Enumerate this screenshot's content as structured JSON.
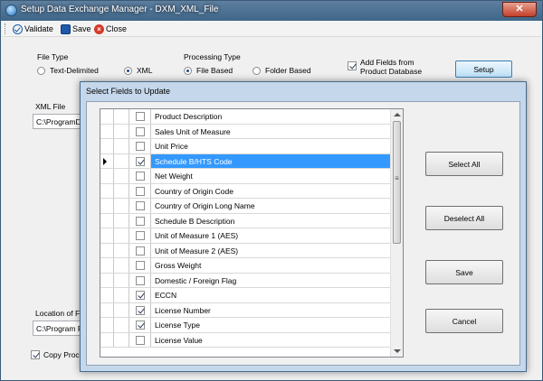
{
  "window": {
    "title": "Setup Data Exchange Manager - DXM_XML_File",
    "close_glyph": "✕"
  },
  "toolbar": {
    "validate_label": "Validate",
    "save_label": "Save",
    "close_label": "Close"
  },
  "file_type": {
    "label": "File Type",
    "options": [
      "Text-Delimited",
      "XML"
    ],
    "selected": "XML"
  },
  "processing_type": {
    "label": "Processing Type",
    "options": [
      "File Based",
      "Folder Based"
    ],
    "selected": "File Based"
  },
  "add_fields": {
    "label_line1": "Add Fields from",
    "label_line2": "Product Database",
    "checked": true
  },
  "setup_button": {
    "label": "Setup"
  },
  "xml_file": {
    "label": "XML File",
    "value": "C:\\ProgramDat"
  },
  "location_of_file": {
    "label": "Location of File",
    "value": "C:\\Program File"
  },
  "copy_process": {
    "label": "Copy Proces",
    "checked": true
  },
  "dialog": {
    "title": "Select Fields to Update",
    "rows": [
      {
        "label": "Product Description",
        "checked": false,
        "selected": false
      },
      {
        "label": "Sales Unit of Measure",
        "checked": false,
        "selected": false
      },
      {
        "label": "Unit Price",
        "checked": false,
        "selected": false
      },
      {
        "label": "Schedule B/HTS Code",
        "checked": true,
        "selected": true
      },
      {
        "label": "Net Weight",
        "checked": false,
        "selected": false
      },
      {
        "label": "Country of Origin Code",
        "checked": false,
        "selected": false
      },
      {
        "label": "Country of Origin Long Name",
        "checked": false,
        "selected": false
      },
      {
        "label": "Schedule B Description",
        "checked": false,
        "selected": false
      },
      {
        "label": "Unit of Measure 1 (AES)",
        "checked": false,
        "selected": false
      },
      {
        "label": "Unit of Measure 2 (AES)",
        "checked": false,
        "selected": false
      },
      {
        "label": "Gross Weight",
        "checked": false,
        "selected": false
      },
      {
        "label": "Domestic / Foreign Flag",
        "checked": false,
        "selected": false
      },
      {
        "label": "ECCN",
        "checked": true,
        "selected": false
      },
      {
        "label": "License Number",
        "checked": true,
        "selected": false
      },
      {
        "label": "License Type",
        "checked": true,
        "selected": false
      },
      {
        "label": "License Value",
        "checked": false,
        "selected": false
      }
    ],
    "buttons": {
      "select_all": "Select All",
      "deselect_all": "Deselect All",
      "save": "Save",
      "cancel": "Cancel"
    }
  }
}
